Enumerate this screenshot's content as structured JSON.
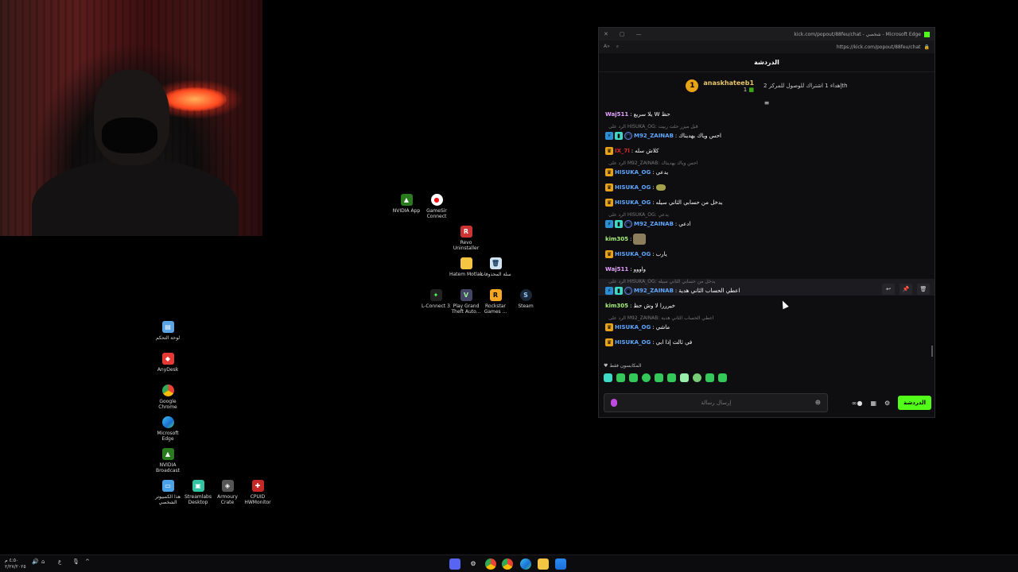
{
  "desktop": {
    "icons": [
      {
        "label": "NVIDIA App",
        "icon": "nvidia-app-icon"
      },
      {
        "label": "GameSir Connect",
        "icon": "gamesir-icon"
      },
      {
        "label": "Revo Uninstaller",
        "icon": "revo-uninstaller-icon"
      },
      {
        "label": "Hatem Motlak",
        "icon": "folder-icon"
      },
      {
        "label": "سلة المحذوفات",
        "icon": "recycle-bin-icon"
      },
      {
        "label": "L-Connect 3",
        "icon": "lconnect-icon"
      },
      {
        "label": "Play Grand Theft Auto...",
        "icon": "gta-icon"
      },
      {
        "label": "Rockstar Games ...",
        "icon": "rockstar-icon"
      },
      {
        "label": "Steam",
        "icon": "steam-icon"
      },
      {
        "label": "لوحة التحكم",
        "icon": "control-panel-icon"
      },
      {
        "label": "AnyDesk",
        "icon": "anydesk-icon"
      },
      {
        "label": "Google Chrome",
        "icon": "chrome-icon"
      },
      {
        "label": "Microsoft Edge",
        "icon": "edge-icon"
      },
      {
        "label": "NVIDIA Broadcast",
        "icon": "nvidia-broadcast-icon"
      },
      {
        "label": "هذا الكمبيوتر الشخصي",
        "icon": "this-pc-icon"
      },
      {
        "label": "Streamlabs Desktop",
        "icon": "streamlabs-icon"
      },
      {
        "label": "Armoury Crate",
        "icon": "armoury-crate-icon"
      },
      {
        "label": "CPUID HWMonitor",
        "icon": "hwmonitor-icon"
      }
    ]
  },
  "window": {
    "title": "kick.com/popout/88feu/chat - شخصي - Microsoft Edge",
    "url": "https://kick.com/popout/88feu/chat",
    "chat_title": "الدردشة"
  },
  "pinned": {
    "rank": "1",
    "username": "anaskhateeb1",
    "count": "1",
    "gift_text": "إهداء 1 اشتراك للوصول للمركز 2th"
  },
  "messages": [
    {
      "user": "Waj511",
      "user_color": "#e5a1ff",
      "text": "يلا سريع W حظ",
      "badges": []
    },
    {
      "reply": "الرد على HISUKA_OG: قبل ميزر حلت ربيت",
      "user": "M92_ZAINAB",
      "user_color": "#5ea6ff",
      "text": "احس وياك يهديناك",
      "badges": [
        "blue",
        "teal",
        "sub"
      ]
    },
    {
      "user": "IX_7l",
      "user_color": "#e0282b",
      "text": "كلاش سله",
      "badges": [
        "crown"
      ]
    },
    {
      "reply": "الرد على M92_ZAINAB: احس وياك يهديناك",
      "user": "HISUKA_OG",
      "user_color": "#5ea6ff",
      "text": "يدعي",
      "badges": [
        "crown"
      ]
    },
    {
      "user": "HISUKA_OG",
      "user_color": "#5ea6ff",
      "text": "",
      "emote": "small",
      "badges": [
        "crown"
      ]
    },
    {
      "user": "HISUKA_OG",
      "user_color": "#5ea6ff",
      "text": "يدخل من حسابي الثاني سيله",
      "badges": [
        "crown"
      ]
    },
    {
      "reply": "الرد على HISUKA_OG: يدعي",
      "user": "M92_ZAINAB",
      "user_color": "#5ea6ff",
      "text": "ادعي",
      "badges": [
        "blue",
        "teal",
        "sub"
      ]
    },
    {
      "user": "kim305",
      "user_color": "#a6f07a",
      "text": "",
      "emote": "large",
      "badges": []
    },
    {
      "user": "HISUKA_OG",
      "user_color": "#5ea6ff",
      "text": "يارب",
      "badges": [
        "crown"
      ]
    },
    {
      "user": "Waj511",
      "user_color": "#e5a1ff",
      "text": "واووو",
      "badges": []
    },
    {
      "reply": "الرد على HISUKA_OG: يدخل من حسابي الثاني سيله",
      "user": "M92_ZAINAB",
      "user_color": "#5ea6ff",
      "text": "اعطي الحساب الثاني هدية",
      "badges": [
        "blue",
        "teal",
        "sub"
      ],
      "highlight": true
    },
    {
      "user": "kim305",
      "user_color": "#a6f07a",
      "text": "خيرررا لا وش حظ",
      "badges": []
    },
    {
      "reply": "الرد على M92_ZAINAB: اعطي الحساب الثاني هدية",
      "user": "HISUKA_OG",
      "user_color": "#5ea6ff",
      "text": "ماشي",
      "badges": [
        "crown"
      ]
    },
    {
      "user": "HISUKA_OG",
      "user_color": "#5ea6ff",
      "text": "في ثالث إذا ابي",
      "badges": [
        "crown"
      ]
    }
  ],
  "emote_bar_label": "المكابسون فقط",
  "input": {
    "placeholder": "إرسال رسالة",
    "send_label": "الدردشة"
  },
  "taskbar": {
    "clock_time": "٤:٥٠ م",
    "clock_date": "٢/٢٧/٢٠٢٥",
    "lang": "ع"
  }
}
